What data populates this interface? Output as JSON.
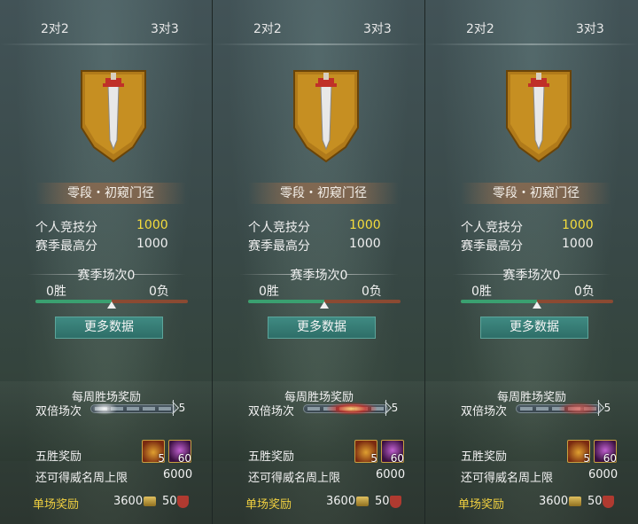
{
  "panels": [
    {
      "tabs": [
        "2对2",
        "3对3"
      ],
      "rank_name": "零段・初窥门径",
      "personal_score_label": "个人竞技分",
      "personal_score_value": "1000",
      "season_high_label": "赛季最高分",
      "season_high_value": "1000",
      "season_matches": "赛季场次0",
      "wins": "0胜",
      "losses": "0负",
      "win_ratio": 0.5,
      "more_button": "更多数据",
      "weekly_reward_title": "每周胜场奖励",
      "double_label": "双倍场次",
      "double_count": "5",
      "five_win_label": "五胜奖励",
      "item1_count": "5",
      "item2_count": "60",
      "prestige_limit_label": "还可得威名周上限",
      "prestige_limit_value": "6000",
      "single_reward_label": "单场奖励",
      "single_reward_coins": "3600",
      "single_reward_shield": "50"
    },
    {
      "tabs": [
        "2对2",
        "3对3"
      ],
      "rank_name": "零段・初窥门径",
      "personal_score_label": "个人竞技分",
      "personal_score_value": "1000",
      "season_high_label": "赛季最高分",
      "season_high_value": "1000",
      "season_matches": "赛季场次0",
      "wins": "0胜",
      "losses": "0负",
      "win_ratio": 0.5,
      "more_button": "更多数据",
      "weekly_reward_title": "每周胜场奖励",
      "double_label": "双倍场次",
      "double_count": "5",
      "five_win_label": "五胜奖励",
      "item1_count": "5",
      "item2_count": "60",
      "prestige_limit_label": "还可得威名周上限",
      "prestige_limit_value": "6000",
      "single_reward_label": "单场奖励",
      "single_reward_coins": "3600",
      "single_reward_shield": "50"
    },
    {
      "tabs": [
        "2对2",
        "3对3"
      ],
      "rank_name": "零段・初窥门径",
      "personal_score_label": "个人竞技分",
      "personal_score_value": "1000",
      "season_high_label": "赛季最高分",
      "season_high_value": "1000",
      "season_matches": "赛季场次0",
      "wins": "0胜",
      "losses": "0负",
      "win_ratio": 0.5,
      "more_button": "更多数据",
      "weekly_reward_title": "每周胜场奖励",
      "double_label": "双倍场次",
      "double_count": "5",
      "five_win_label": "五胜奖励",
      "item1_count": "5",
      "item2_count": "60",
      "prestige_limit_label": "还可得威名周上限",
      "prestige_limit_value": "6000",
      "single_reward_label": "单场奖励",
      "single_reward_coins": "3600",
      "single_reward_shield": "50"
    }
  ],
  "icons": {
    "emblem": "sword-banner-icon",
    "chest": "treasure-chest-icon",
    "gem": "purple-gem-icon",
    "coin": "coin-icon",
    "shield": "shield-icon"
  },
  "colors": {
    "gold_text": "#f5dc3c",
    "win_bar": "#3aa070",
    "loss_bar": "#8b4a32",
    "button": "#2e6e68"
  }
}
